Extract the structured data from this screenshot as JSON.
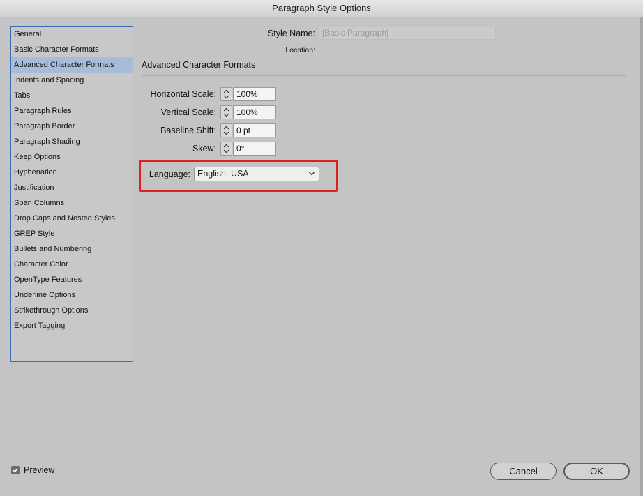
{
  "window": {
    "title": "Paragraph Style Options"
  },
  "sidebar": {
    "items": [
      {
        "label": "General"
      },
      {
        "label": "Basic Character Formats"
      },
      {
        "label": "Advanced Character Formats",
        "selected": true
      },
      {
        "label": "Indents and Spacing"
      },
      {
        "label": "Tabs"
      },
      {
        "label": "Paragraph Rules"
      },
      {
        "label": "Paragraph Border"
      },
      {
        "label": "Paragraph Shading"
      },
      {
        "label": "Keep Options"
      },
      {
        "label": "Hyphenation"
      },
      {
        "label": "Justification"
      },
      {
        "label": "Span Columns"
      },
      {
        "label": "Drop Caps and Nested Styles"
      },
      {
        "label": "GREP Style"
      },
      {
        "label": "Bullets and Numbering"
      },
      {
        "label": "Character Color"
      },
      {
        "label": "OpenType Features"
      },
      {
        "label": "Underline Options"
      },
      {
        "label": "Strikethrough Options"
      },
      {
        "label": "Export Tagging"
      }
    ],
    "selected_color": "#a6bcd9",
    "border_color": "#3c6bb5"
  },
  "header": {
    "style_name_label": "Style Name:",
    "style_name_value": "[Basic Paragraph]",
    "location_label": "Location:"
  },
  "section": {
    "title": "Advanced Character Formats"
  },
  "fields": {
    "horizontal_scale": {
      "label": "Horizontal Scale:",
      "value": "100%"
    },
    "vertical_scale": {
      "label": "Vertical Scale:",
      "value": "100%"
    },
    "baseline_shift": {
      "label": "Baseline Shift:",
      "value": "0 pt"
    },
    "skew": {
      "label": "Skew:",
      "value": "0°"
    }
  },
  "language": {
    "label": "Language:",
    "value": "English: USA",
    "highlight_color": "#e02020"
  },
  "footer": {
    "preview_label": "Preview",
    "preview_checked": true,
    "cancel_label": "Cancel",
    "ok_label": "OK"
  },
  "icons": {
    "stepper": "up-down-arrows-icon",
    "dropdown": "chevron-down-icon",
    "checkbox": "checkmark-icon"
  }
}
